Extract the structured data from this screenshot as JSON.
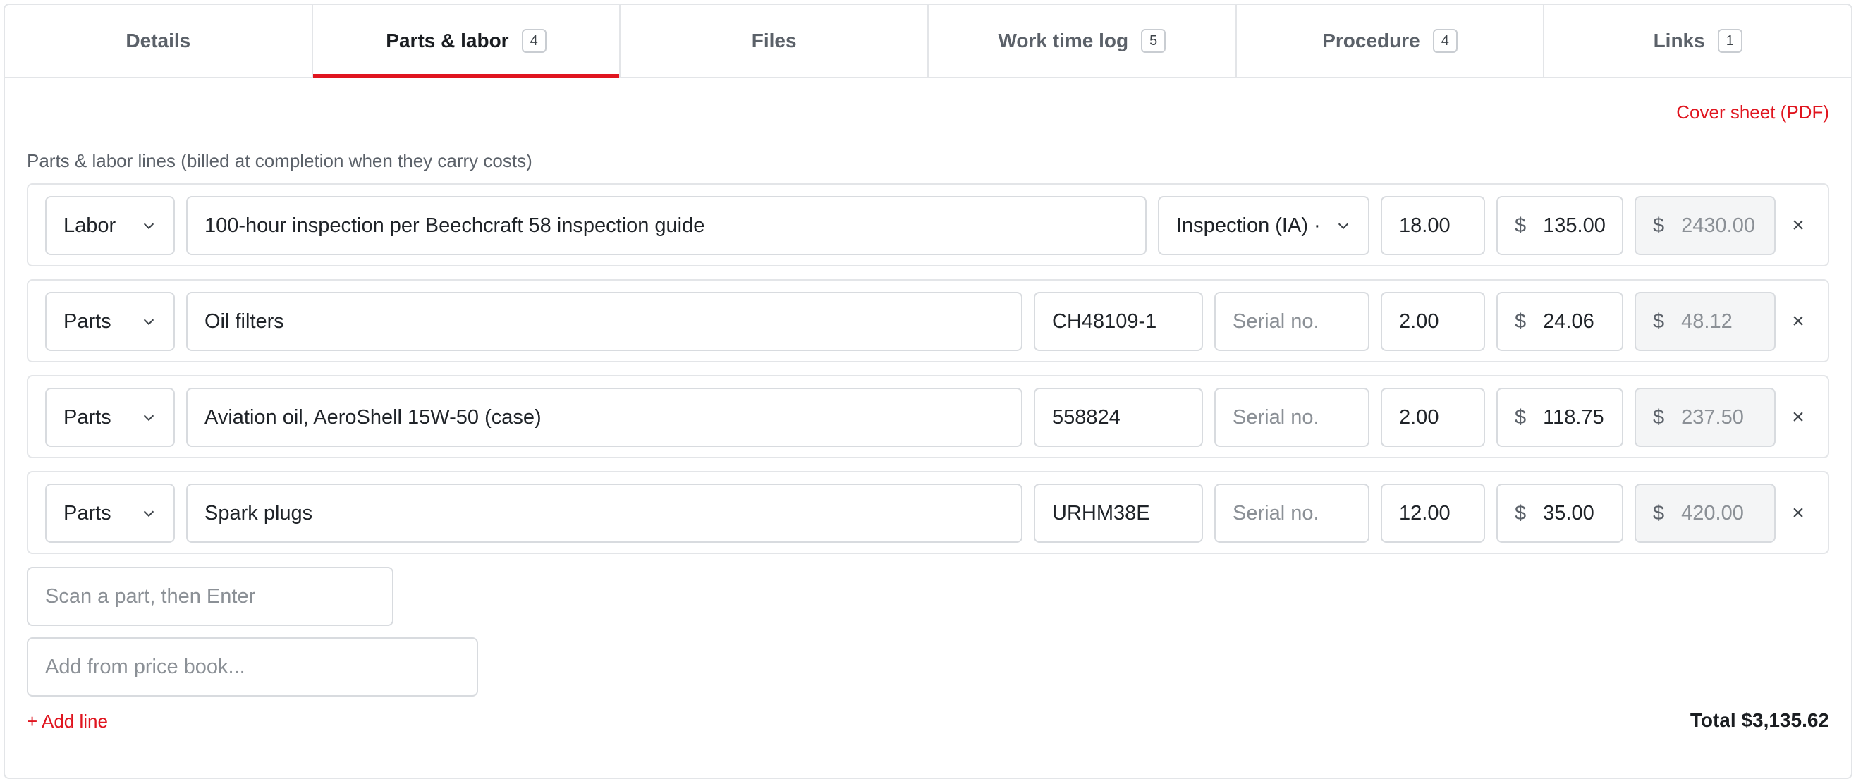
{
  "tabs": [
    {
      "label": "Details",
      "count": null
    },
    {
      "label": "Parts & labor",
      "count": "4"
    },
    {
      "label": "Files",
      "count": null
    },
    {
      "label": "Work time log",
      "count": "5"
    },
    {
      "label": "Procedure",
      "count": "4"
    },
    {
      "label": "Links",
      "count": "1"
    }
  ],
  "active_tab": "Parts & labor",
  "cover_sheet_link": "Cover sheet (PDF)",
  "section_label": "Parts & labor lines (billed at completion when they carry costs)",
  "currency_symbol": "$",
  "remove_glyph": "×",
  "lines": [
    {
      "type": "Labor",
      "description": "100-hour inspection per Beechcraft 58 inspection guide",
      "rate_category": "Inspection (IA) ·",
      "quantity": "18.00",
      "unit_price": "135.00",
      "line_total": "2430.00"
    },
    {
      "type": "Parts",
      "description": "Oil filters",
      "part_number": "CH48109-1",
      "serial_placeholder": "Serial no.",
      "quantity": "2.00",
      "unit_price": "24.06",
      "line_total": "48.12"
    },
    {
      "type": "Parts",
      "description": "Aviation oil, AeroShell 15W-50 (case)",
      "part_number": "558824",
      "serial_placeholder": "Serial no.",
      "quantity": "2.00",
      "unit_price": "118.75",
      "line_total": "237.50"
    },
    {
      "type": "Parts",
      "description": "Spark plugs",
      "part_number": "URHM38E",
      "serial_placeholder": "Serial no.",
      "quantity": "12.00",
      "unit_price": "35.00",
      "line_total": "420.00"
    }
  ],
  "scan_placeholder": "Scan a part, then Enter",
  "price_book_placeholder": "Add from price book...",
  "add_line_label": "+ Add line",
  "total_label": "Total $3,135.62",
  "colors": {
    "accent": "#e0151f",
    "border": "#e3e5e8",
    "muted_text": "#5b6169",
    "readonly_bg": "#f4f5f6"
  }
}
